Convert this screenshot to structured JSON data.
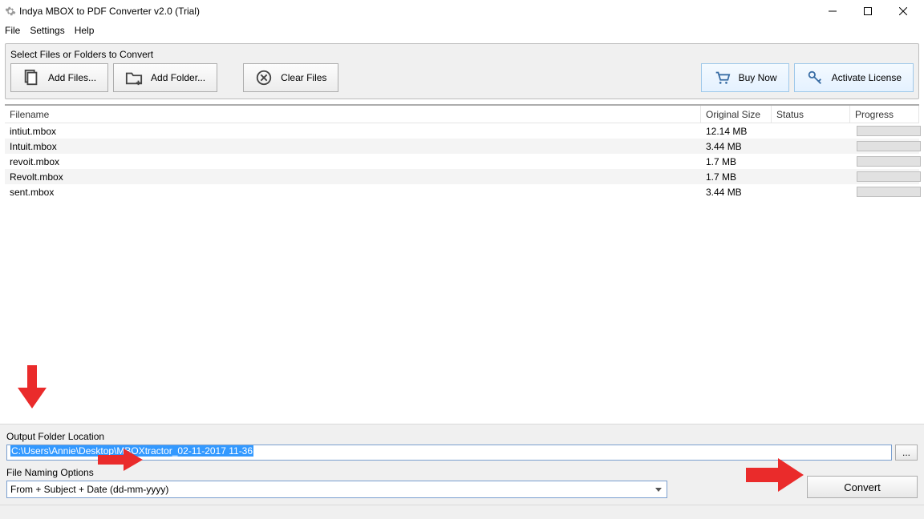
{
  "window": {
    "title": "Indya MBOX to PDF Converter v2.0 (Trial)"
  },
  "menu": {
    "file": "File",
    "settings": "Settings",
    "help": "Help"
  },
  "toolbar": {
    "section_label": "Select Files or Folders to Convert",
    "add_files": "Add Files...",
    "add_folder": "Add Folder...",
    "clear_files": "Clear Files",
    "buy_now": "Buy Now",
    "activate_license": "Activate License"
  },
  "table": {
    "headers": {
      "filename": "Filename",
      "size": "Original Size",
      "status": "Status",
      "progress": "Progress"
    },
    "rows": [
      {
        "filename": "intiut.mbox",
        "size": "12.14 MB",
        "status": ""
      },
      {
        "filename": "Intuit.mbox",
        "size": "3.44 MB",
        "status": ""
      },
      {
        "filename": "revoit.mbox",
        "size": "1.7 MB",
        "status": ""
      },
      {
        "filename": "Revolt.mbox",
        "size": "1.7 MB",
        "status": ""
      },
      {
        "filename": "sent.mbox",
        "size": "3.44 MB",
        "status": ""
      }
    ]
  },
  "output": {
    "label": "Output Folder Location",
    "path": "C:\\Users\\Annie\\Desktop\\MBOXtractor_02-11-2017 11-36",
    "browse": "..."
  },
  "naming": {
    "label": "File Naming Options",
    "selected": "From + Subject + Date (dd-mm-yyyy)"
  },
  "actions": {
    "convert": "Convert"
  }
}
